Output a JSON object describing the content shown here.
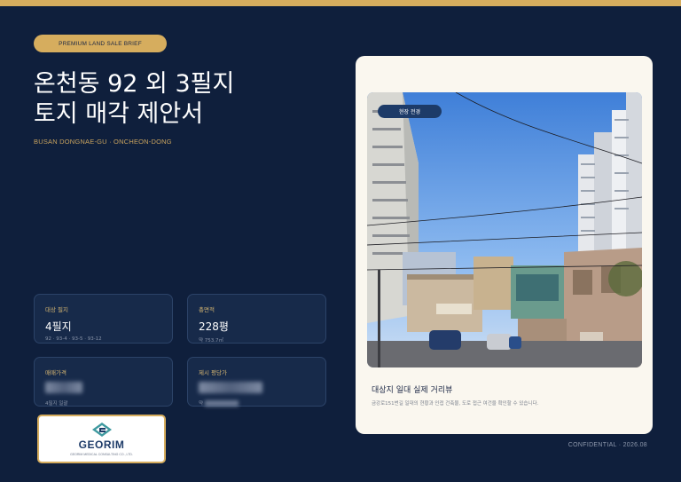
{
  "header": {
    "badge": "PREMIUM LAND SALE BRIEF",
    "title_line1": "온천동 92 외 3필지",
    "title_line2": "토지 매각 제안서",
    "subtitle": "BUSAN DONGNAE-GU · ONCHEON-DONG"
  },
  "cards": {
    "parcels": {
      "label": "대상 필지",
      "value": "4필지",
      "note": "92 · 93-4 · 93-5 · 93-12"
    },
    "area": {
      "label": "총면적",
      "value": "228평",
      "note": "약 753.7㎡"
    },
    "price": {
      "label": "매매가격",
      "note": "4필지 일괄"
    },
    "unit_price": {
      "label": "제시 평당가",
      "note_prefix": "약"
    }
  },
  "logo": {
    "name": "GEORIM",
    "tagline": "GEORIM MEDICAL CONSULTING CO., LTD."
  },
  "photo_panel": {
    "tag": "현장 전경",
    "caption_title": "대상지 일대 실제 거리뷰",
    "caption_desc": "금강로151번길 일대의 현황과 인접 건축물, 도로 접근 여건을 확인할 수 있습니다."
  },
  "footer": "CONFIDENTIAL · 2026.08",
  "colors": {
    "background": "#0f1f3c",
    "gold": "#d6ad5e",
    "card": "#172a4a",
    "panel": "#faf7ef",
    "navy": "#1d3b68"
  }
}
